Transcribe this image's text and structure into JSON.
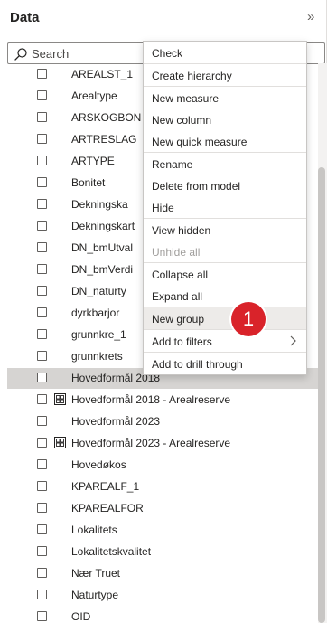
{
  "pane": {
    "title": "Data"
  },
  "search": {
    "placeholder": "Search",
    "value": ""
  },
  "fields": [
    {
      "label": "AREALST_1",
      "type": "field",
      "selected": false
    },
    {
      "label": "Arealtype",
      "type": "field",
      "selected": false
    },
    {
      "label": "ARSKOGBON",
      "type": "field",
      "selected": false
    },
    {
      "label": "ARTRESLAG",
      "type": "field",
      "selected": false
    },
    {
      "label": "ARTYPE",
      "type": "field",
      "selected": false
    },
    {
      "label": "Bonitet",
      "type": "field",
      "selected": false
    },
    {
      "label": "Dekningska",
      "type": "field",
      "selected": false
    },
    {
      "label": "Dekningskart",
      "type": "field",
      "selected": false
    },
    {
      "label": "DN_bmUtval",
      "type": "field",
      "selected": false
    },
    {
      "label": "DN_bmVerdi",
      "type": "field",
      "selected": false
    },
    {
      "label": "DN_naturty",
      "type": "field",
      "selected": false
    },
    {
      "label": "dyrkbarjor",
      "type": "field",
      "selected": false
    },
    {
      "label": "grunnkre_1",
      "type": "field",
      "selected": false
    },
    {
      "label": "grunnkrets",
      "type": "field",
      "selected": false
    },
    {
      "label": "Hovedformål 2018",
      "type": "field",
      "selected": true
    },
    {
      "label": "Hovedformål 2018 - Arealreserve",
      "type": "group",
      "selected": false
    },
    {
      "label": "Hovedformål 2023",
      "type": "field",
      "selected": false
    },
    {
      "label": "Hovedformål 2023 - Arealreserve",
      "type": "group",
      "selected": false
    },
    {
      "label": "Hovedøkos",
      "type": "field",
      "selected": false
    },
    {
      "label": "KPAREALF_1",
      "type": "field",
      "selected": false
    },
    {
      "label": "KPAREALFOR",
      "type": "field",
      "selected": false
    },
    {
      "label": "Lokalitets",
      "type": "field",
      "selected": false
    },
    {
      "label": "Lokalitetskvalitet",
      "type": "field",
      "selected": false
    },
    {
      "label": "Nær Truet",
      "type": "field",
      "selected": false
    },
    {
      "label": "Naturtype",
      "type": "field",
      "selected": false
    },
    {
      "label": "OID",
      "type": "field",
      "selected": false
    }
  ],
  "context_menu": {
    "items": [
      {
        "label": "Check",
        "enabled": true,
        "hovered": false
      },
      {
        "label": "Create hierarchy",
        "enabled": true,
        "hovered": false
      },
      {
        "label": "New measure",
        "enabled": true,
        "hovered": false
      },
      {
        "label": "New column",
        "enabled": true,
        "hovered": false
      },
      {
        "label": "New quick measure",
        "enabled": true,
        "hovered": false
      },
      {
        "label": "Rename",
        "enabled": true,
        "hovered": false
      },
      {
        "label": "Delete from model",
        "enabled": true,
        "hovered": false
      },
      {
        "label": "Hide",
        "enabled": true,
        "hovered": false
      },
      {
        "label": "View hidden",
        "enabled": true,
        "hovered": false
      },
      {
        "label": "Unhide all",
        "enabled": false,
        "hovered": false
      },
      {
        "label": "Collapse all",
        "enabled": true,
        "hovered": false
      },
      {
        "label": "Expand all",
        "enabled": true,
        "hovered": false
      },
      {
        "label": "New group",
        "enabled": true,
        "hovered": true
      },
      {
        "label": "Add to filters",
        "enabled": true,
        "hovered": false,
        "submenu": true
      },
      {
        "label": "Add to drill through",
        "enabled": true,
        "hovered": false
      }
    ]
  },
  "step_badge": {
    "label": "1",
    "color": "#d9232a"
  }
}
